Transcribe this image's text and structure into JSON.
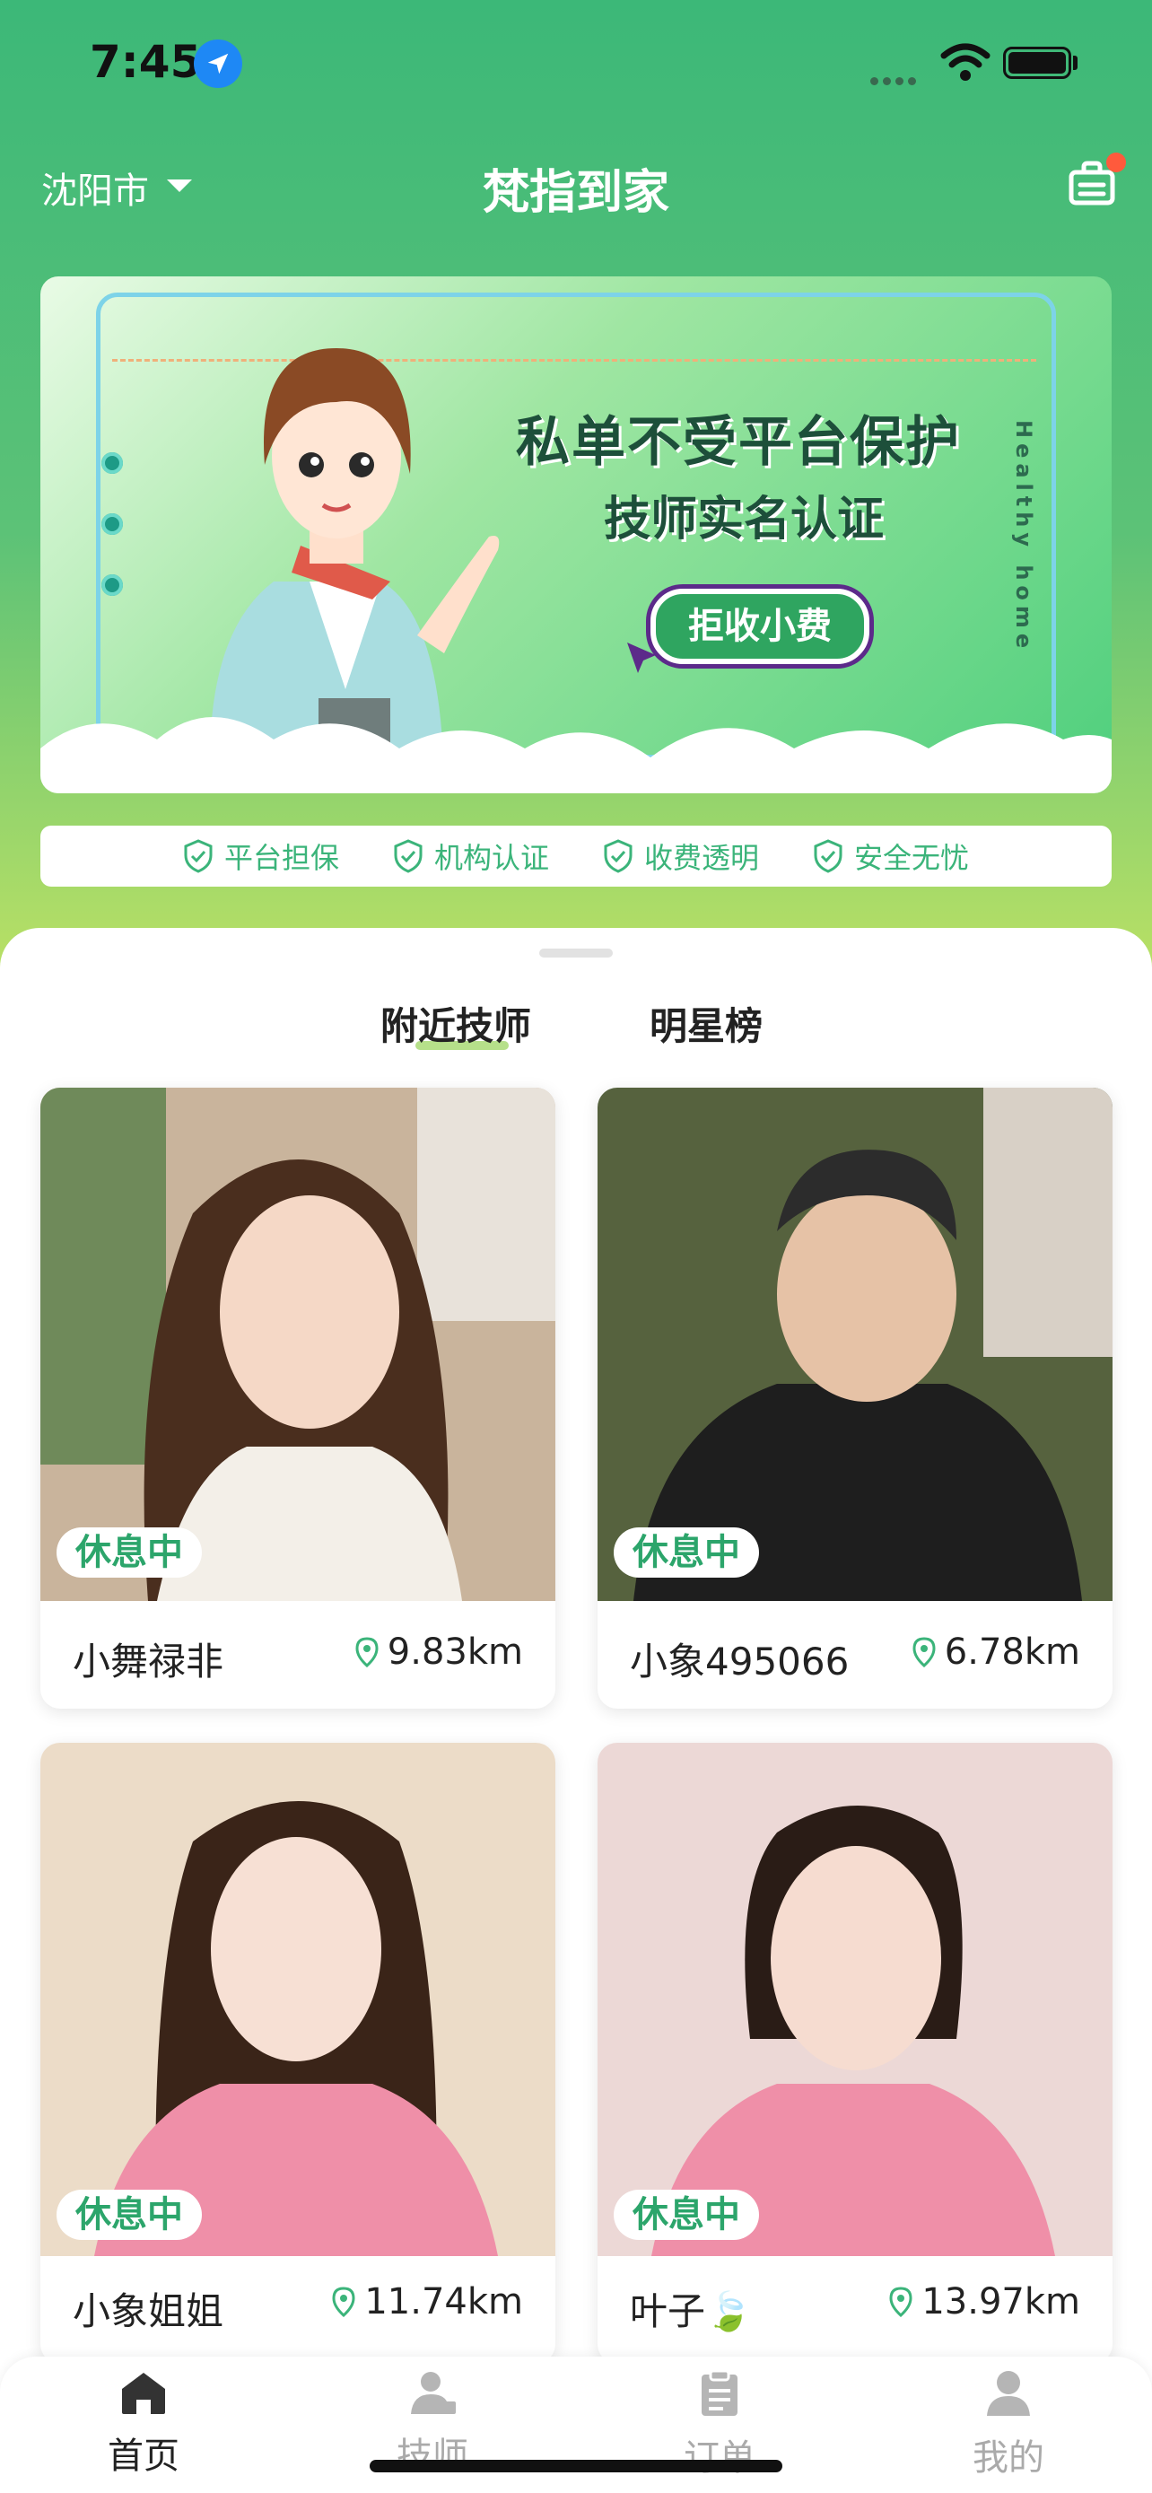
{
  "status_bar": {
    "time": "7:45"
  },
  "header": {
    "city": "沈阳市",
    "title": "梵指到家"
  },
  "banner": {
    "headline": "私单不受平台保护",
    "subline": "技师实名认证",
    "button": "拒收小费",
    "side_text": "Healthy home"
  },
  "trust": [
    "平台担保",
    "机构认证",
    "收费透明",
    "安全无忧"
  ],
  "tabs": [
    {
      "label": "附近技师",
      "active": true
    },
    {
      "label": "明星榜",
      "active": false
    }
  ],
  "technicians": [
    {
      "name": "小舞禄非",
      "distance": "9.83km",
      "status": "休息中"
    },
    {
      "name": "小象495066",
      "distance": "6.78km",
      "status": "休息中"
    },
    {
      "name": "小象姐姐",
      "distance": "11.74km",
      "status": "休息中"
    },
    {
      "name": "叶子🍃",
      "distance": "13.97km",
      "status": "休息中"
    }
  ],
  "tabbar": [
    {
      "label": "首页",
      "icon": "home-icon",
      "active": true
    },
    {
      "label": "技师",
      "icon": "technician-icon",
      "active": false
    },
    {
      "label": "订单",
      "icon": "order-icon",
      "active": false
    },
    {
      "label": "我的",
      "icon": "profile-icon",
      "active": false
    }
  ],
  "colors": {
    "accent": "#3bb47a",
    "header_top": "#3cb878",
    "header_bottom": "#b9e065",
    "notification_dot": "#ff5a3c"
  }
}
